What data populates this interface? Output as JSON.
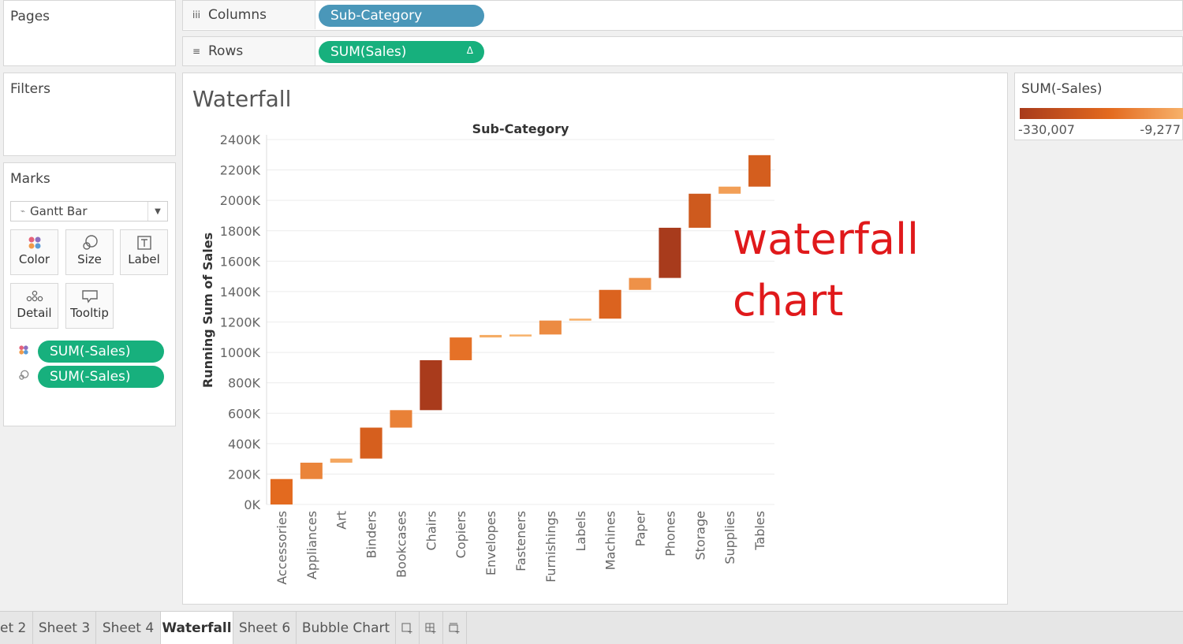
{
  "shelves": {
    "pages_label": "Pages",
    "filters_label": "Filters",
    "columns": {
      "label": "Columns",
      "icon": "columns-icon",
      "pill": "Sub-Category"
    },
    "rows": {
      "label": "Rows",
      "icon": "rows-icon",
      "pill": "SUM(Sales)",
      "pill_badge": "Δ"
    }
  },
  "marks": {
    "title": "Marks",
    "mark_type": "Gantt Bar",
    "buttons": [
      {
        "label": "Color",
        "icon": "color-icon"
      },
      {
        "label": "Size",
        "icon": "size-icon"
      },
      {
        "label": "Label",
        "icon": "label-icon"
      },
      {
        "label": "Detail",
        "icon": "detail-icon"
      },
      {
        "label": "Tooltip",
        "icon": "tooltip-icon"
      }
    ],
    "pills": [
      {
        "label": "SUM(-Sales)",
        "icon": "color-icon"
      },
      {
        "label": "SUM(-Sales)",
        "icon": "size-icon"
      }
    ]
  },
  "sheet": {
    "title": "Waterfall"
  },
  "annotation": {
    "line1": "waterfall",
    "line2": "chart",
    "color": "#e0191b"
  },
  "legend": {
    "title": "SUM(-Sales)",
    "min_label": "-330,007",
    "max_label": "-9,277",
    "colors": [
      "#a83b1c",
      "#e36a1f",
      "#f7b26b"
    ]
  },
  "chart_data": {
    "type": "bar",
    "subtype": "waterfall (gantt)",
    "title": "Sub-Category",
    "xlabel": "",
    "ylabel": "Running Sum of Sales",
    "ylim": [
      0,
      2400000
    ],
    "yticks": [
      "0K",
      "200K",
      "400K",
      "600K",
      "800K",
      "1000K",
      "1200K",
      "1400K",
      "1600K",
      "1800K",
      "2000K",
      "2200K",
      "2400K"
    ],
    "yticks_values": [
      0,
      200000,
      400000,
      600000,
      800000,
      1000000,
      1200000,
      1400000,
      1600000,
      1800000,
      2000000,
      2200000,
      2400000
    ],
    "categories": [
      "Accessories",
      "Appliances",
      "Art",
      "Binders",
      "Bookcases",
      "Chairs",
      "Copiers",
      "Envelopes",
      "Fasteners",
      "Furnishings",
      "Labels",
      "Machines",
      "Paper",
      "Phones",
      "Storage",
      "Supplies",
      "Tables"
    ],
    "values": [
      167380,
      107532,
      27119,
      203413,
      114880,
      328449,
      149528,
      16476,
      3024,
      91705,
      12486,
      189239,
      78479,
      330007,
      223844,
      46674,
      206966
    ],
    "running_sum": [
      167380,
      274912,
      302031,
      505444,
      620324,
      948773,
      1098301,
      1114777,
      1117801,
      1209506,
      1221992,
      1411231,
      1489710,
      1819717,
      2043561,
      2090235,
      2297201
    ],
    "grid": true,
    "legend_position": "right"
  },
  "tabs": [
    "et 2",
    "Sheet 3",
    "Sheet 4",
    "Waterfall",
    "Sheet 6",
    "Bubble Chart"
  ],
  "active_tab": "Waterfall",
  "tab_icons": [
    "new-sheet-icon",
    "new-dashboard-icon",
    "new-story-icon"
  ]
}
